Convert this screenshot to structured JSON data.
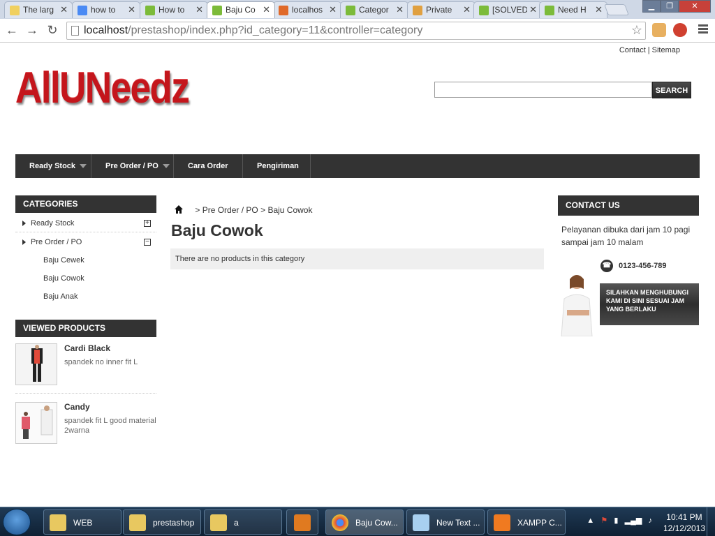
{
  "browser": {
    "tabs": [
      {
        "label": "The larg",
        "color": "#f0d060"
      },
      {
        "label": "how to",
        "color": "#4a8af4"
      },
      {
        "label": "How to",
        "color": "#7cbb3a"
      },
      {
        "label": "Baju Co",
        "color": "#7cbb3a",
        "active": true
      },
      {
        "label": "localhos",
        "color": "#e06a2a"
      },
      {
        "label": "Categor",
        "color": "#7cbb3a"
      },
      {
        "label": "Private",
        "color": "#e0a040"
      },
      {
        "label": "[SOLVED",
        "color": "#7cbb3a"
      },
      {
        "label": "Need H",
        "color": "#7cbb3a"
      }
    ],
    "url_host": "localhost",
    "url_path": "/prestashop/index.php?id_category=11&controller=category"
  },
  "header": {
    "toplinks": [
      "Contact",
      "Sitemap"
    ],
    "logo": "AllUNeedz",
    "search_button": "SEARCH"
  },
  "nav": {
    "items": [
      {
        "label": "Ready Stock",
        "dropdown": true
      },
      {
        "label": "Pre Order / PO",
        "dropdown": true
      },
      {
        "label": "Cara Order",
        "dropdown": false
      },
      {
        "label": "Pengiriman",
        "dropdown": false
      }
    ]
  },
  "categories": {
    "title": "CATEGORIES",
    "items": [
      {
        "label": "Ready Stock",
        "toggle": "+"
      },
      {
        "label": "Pre Order / PO",
        "toggle": "−"
      }
    ],
    "subitems": [
      "Baju Cewek",
      "Baju Cowok",
      "Baju Anak"
    ]
  },
  "viewed": {
    "title": "VIEWED PRODUCTS",
    "items": [
      {
        "name": "Cardi Black",
        "desc": "spandek no inner fit L"
      },
      {
        "name": "Candy",
        "desc": "spandek fit L good material 2warna"
      }
    ]
  },
  "main": {
    "breadcrumb": [
      "Pre Order / PO",
      "Baju Cowok"
    ],
    "title": "Baju Cowok",
    "empty_message": "There are no products in this category"
  },
  "contact": {
    "title": "CONTACT US",
    "text": "Pelayanan dibuka dari jam 10 pagi sampai jam 10 malam",
    "phone": "0123-456-789",
    "cta": "SILAHKAN MENGHUBUNGI KAMI DI SINI SESUAI JAM YANG BERLAKU"
  },
  "taskbar": {
    "items": [
      {
        "label": "WEB",
        "icon": "folder-icon"
      },
      {
        "label": "prestashop",
        "icon": "folder-icon"
      },
      {
        "label": "a",
        "icon": "folder-icon"
      },
      {
        "label": "",
        "icon": "media-player-icon"
      },
      {
        "label": "Baju Cow...",
        "icon": "chrome-icon"
      },
      {
        "label": "New Text ...",
        "icon": "notepad-icon"
      },
      {
        "label": "XAMPP C...",
        "icon": "xampp-icon"
      }
    ],
    "time": "10:41 PM",
    "date": "12/12/2013"
  }
}
